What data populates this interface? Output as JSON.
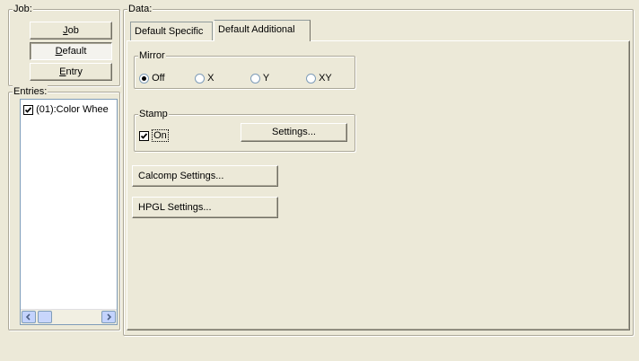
{
  "job_group": {
    "legend": "Job:",
    "buttons": [
      {
        "label": "Job",
        "ul": "J",
        "rest": "ob"
      },
      {
        "label": "Default",
        "ul": "D",
        "rest": "efault"
      },
      {
        "label": "Entry",
        "ul": "E",
        "rest": "ntry"
      }
    ]
  },
  "entries_group": {
    "legend": "Entries:",
    "items": [
      {
        "label": "(01):Color Whee",
        "checked": true
      }
    ]
  },
  "data_group": {
    "legend": "Data:",
    "tabs": [
      {
        "label": "Default Specific",
        "active": false
      },
      {
        "label": "Default Additional",
        "active": true
      }
    ],
    "mirror": {
      "legend": "Mirror",
      "options": [
        "Off",
        "X",
        "Y",
        "XY"
      ],
      "selected": "Off"
    },
    "stamp": {
      "legend": "Stamp",
      "checkbox_label": "On",
      "checked": true,
      "settings_button": "Settings..."
    },
    "calcomp_button": "Calcomp Settings...",
    "hpgl_button": "HPGL Settings..."
  }
}
